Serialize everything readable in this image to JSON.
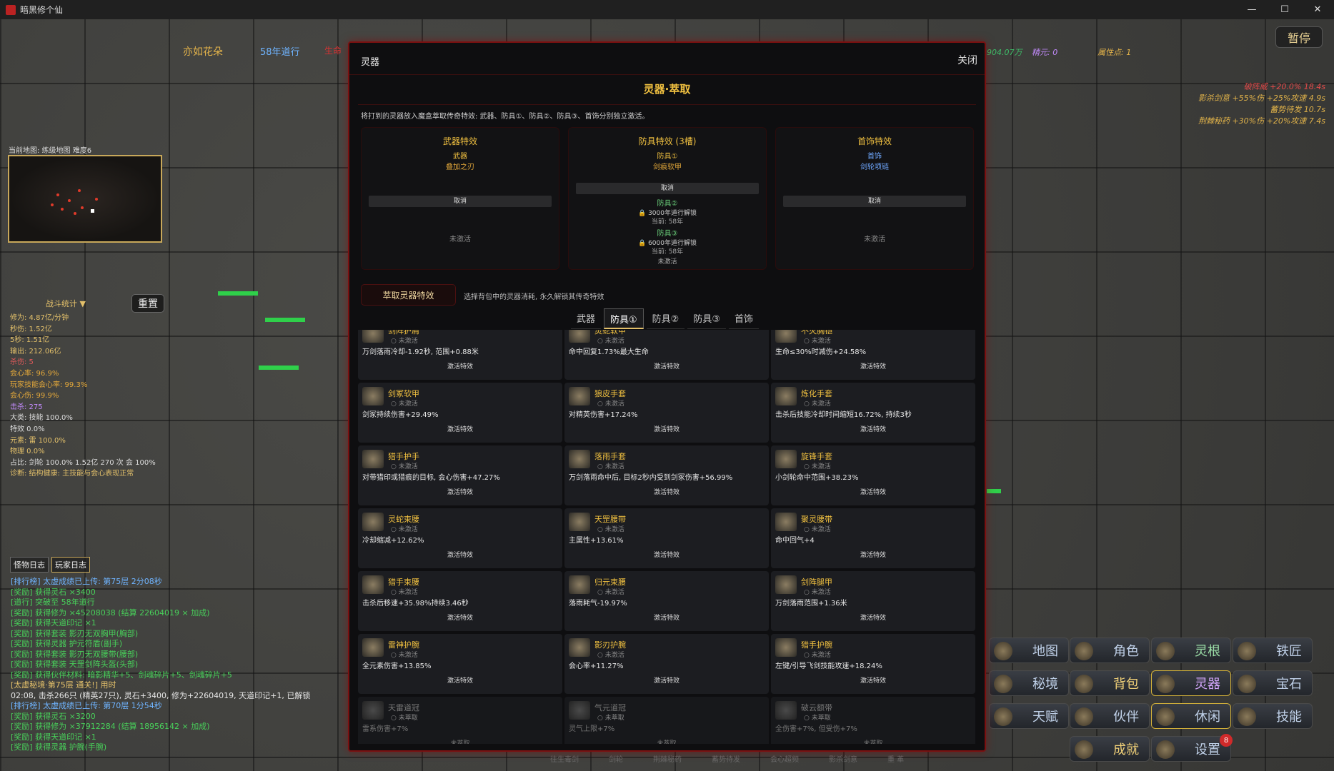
{
  "window": {
    "title": "暗黑修个仙",
    "min": "—",
    "max": "☐",
    "close": "✕"
  },
  "hud": {
    "name": "亦如花朵",
    "years": "58年道行",
    "hp_label": "生命",
    "stat1": "904.07万",
    "stat2": "精元: 0",
    "stat3": "属性点: 1",
    "pause": "暂停",
    "buffs": [
      "破阵威 +20.0% 18.4s",
      "影杀剑意 +55%伤 +25%攻速 4.9s",
      "蓄势待发 10.7s",
      "荆棘秘药 +30%伤 +20%攻速 7.4s"
    ]
  },
  "map": {
    "label": "当前地图: 练级地图 难度6"
  },
  "stats": {
    "title": "战斗统计 ▼",
    "reset": "重置",
    "lines": [
      {
        "t": "修为: 4.87亿/分钟",
        "c": "y"
      },
      {
        "t": "秒伤: 1.52亿",
        "c": "y"
      },
      {
        "t": "5秒: 1.51亿",
        "c": "y"
      },
      {
        "t": "输出: 212.06亿",
        "c": "y"
      },
      {
        "t": "杀伤: 5",
        "c": "r"
      },
      {
        "t": "会心率: 96.9%",
        "c": "o"
      },
      {
        "t": "玩家技能会心率: 99.3%",
        "c": "o"
      },
      {
        "t": "会心伤: 99.9%",
        "c": "o"
      },
      {
        "t": "击杀: 275",
        "c": "p"
      },
      {
        "t": "大类: 技能 100.0%",
        "c": "w"
      },
      {
        "t": "        特效 0.0%",
        "c": "w"
      },
      {
        "t": "元素: 雷 100.0%",
        "c": "y"
      },
      {
        "t": "        物理 0.0%",
        "c": "y"
      },
      {
        "t": "占比: 剑轮 100.0% 1.52亿 270 次 会 100%",
        "c": "w"
      },
      {
        "t": "诊断: 结构健康: 主技能与会心表现正常",
        "c": "y"
      }
    ]
  },
  "log": {
    "tabs": [
      "怪物日志",
      "玩家日志"
    ],
    "lines": [
      {
        "t": "[排行榜] 太虚成绩已上传: 第75层 2分08秒",
        "c": "c-rank"
      },
      {
        "t": "[奖励] 获得灵石 ×3400",
        "c": "c-reward"
      },
      {
        "t": "[道行] 突破至 58年道行",
        "c": "c-reward"
      },
      {
        "t": "[奖励] 获得修为 ×45208038 (结算 22604019 × 加成)",
        "c": "c-reward"
      },
      {
        "t": "[奖励] 获得天道印记 ×1",
        "c": "c-reward"
      },
      {
        "t": "[奖励] 获得套装 影刃无双胸甲(胸部)",
        "c": "c-reward"
      },
      {
        "t": "[奖励] 获得灵器 护元符盾(副手)",
        "c": "c-reward"
      },
      {
        "t": "[奖励] 获得套装 影刃无双腰带(腰部)",
        "c": "c-reward"
      },
      {
        "t": "[奖励] 获得套装 天罡剑阵头盔(头部)",
        "c": "c-reward"
      },
      {
        "t": "[奖励] 获得伙伴材料: 暗影精华+5、剑魂碎片+5、剑魂碎片+5",
        "c": "c-reward"
      },
      {
        "t": "[太虚秘境·第75层 通关!] 用时",
        "c": "c-pass"
      },
      {
        "t": "02:08, 击杀266只 (精英27只), 灵石+3400, 修为+22604019, 天道印记+1, 已解锁",
        "c": "c-white"
      },
      {
        "t": "[排行榜] 太虚成绩已上传: 第70层 1分54秒",
        "c": "c-rank"
      },
      {
        "t": "[奖励] 获得灵石 ×3200",
        "c": "c-reward"
      },
      {
        "t": "[奖励] 获得修为 ×37912284 (结算 18956142 × 加成)",
        "c": "c-reward"
      },
      {
        "t": "[奖励] 获得天道印记 ×1",
        "c": "c-reward"
      },
      {
        "t": "[奖励] 获得灵器 护腕(手腕)",
        "c": "c-reward"
      }
    ]
  },
  "buttons": [
    {
      "label": "地图",
      "cls": ""
    },
    {
      "label": "角色",
      "cls": ""
    },
    {
      "label": "灵根",
      "cls": "green"
    },
    {
      "label": "铁匠",
      "cls": ""
    },
    {
      "label": "秘境",
      "cls": ""
    },
    {
      "label": "背包",
      "cls": "gold"
    },
    {
      "label": "灵器",
      "cls": "purple hi"
    },
    {
      "label": "宝石",
      "cls": ""
    },
    {
      "label": "天赋",
      "cls": ""
    },
    {
      "label": "伙伴",
      "cls": ""
    },
    {
      "label": "休闲",
      "cls": "hi"
    },
    {
      "label": "技能",
      "cls": ""
    },
    {
      "label": "成就",
      "cls": "gold"
    },
    {
      "label": "设置",
      "cls": ""
    }
  ],
  "achievement_badge": "8",
  "bottom_strip": [
    "往生毒剑",
    "剑轮",
    "荆棘秘药",
    "蓄势待发",
    "会心超频",
    "影杀剑意",
    "重 革"
  ],
  "modal": {
    "title": "灵器",
    "close": "关闭",
    "section_title": "灵器·萃取",
    "desc": "将打到的灵器放入魔盒萃取传奇特效: 武器、防具①、防具②、防具③、首饰分别独立激活。",
    "cards": {
      "weapon": {
        "title": "武器特效",
        "slot": "武器",
        "effect": "叠加之刃",
        "cancel": "取消",
        "status": "未激活"
      },
      "armor": {
        "title": "防具特效 (3槽)",
        "slot1": "防具①",
        "effect1": "剑痕软甲",
        "cancel": "取消",
        "slot2": "防具②",
        "lock2": "🔒 3000年道行解锁",
        "cur2": "当前: 58年",
        "slot3": "防具③",
        "lock3": "🔒 6000年道行解锁",
        "cur3": "当前: 58年",
        "status": "未激活"
      },
      "jewel": {
        "title": "首饰特效",
        "slot": "首饰",
        "effect": "剑轮项链",
        "cancel": "取消",
        "status": "未激活"
      }
    },
    "extract_btn": "萃取灵器特效",
    "extract_desc": "选择背包中的灵器消耗, 永久解锁其传奇特效",
    "tabs": [
      "武器",
      "防具①",
      "防具②",
      "防具③",
      "首饰"
    ],
    "active_tab": 1,
    "items": [
      {
        "name": "剑阵护肩",
        "state": "○ 未激活",
        "effect": "万剑落雨冷却-1.92秒, 范围+0.88米",
        "action": "激活特效",
        "locked": false
      },
      {
        "name": "灵蛇软甲",
        "state": "○ 未激活",
        "effect": "命中回复1.73%最大生命",
        "action": "激活特效",
        "locked": false
      },
      {
        "name": "不灭胸铠",
        "state": "○ 未激活",
        "effect": "生命≤30%时减伤+24.58%",
        "action": "激活特效",
        "locked": false
      },
      {
        "name": "剑冢软甲",
        "state": "○ 未激活",
        "effect": "剑冢持续伤害+29.49%",
        "action": "激活特效",
        "locked": false
      },
      {
        "name": "狼皮手套",
        "state": "○ 未激活",
        "effect": "对精英伤害+17.24%",
        "action": "激活特效",
        "locked": false
      },
      {
        "name": "炼化手套",
        "state": "○ 未激活",
        "effect": "击杀后技能冷却时间缩短16.72%, 持续3秒",
        "action": "激活特效",
        "locked": false
      },
      {
        "name": "猎手护手",
        "state": "○ 未激活",
        "effect": "对带猎印或猎痕的目标, 会心伤害+47.27%",
        "action": "激活特效",
        "locked": false
      },
      {
        "name": "落雨手套",
        "state": "○ 未激活",
        "effect": "万剑落雨命中后, 目标2秒内受到剑冢伤害+56.99%",
        "action": "激活特效",
        "locked": false
      },
      {
        "name": "旋锋手套",
        "state": "○ 未激活",
        "effect": "小剑轮命中范围+38.23%",
        "action": "激活特效",
        "locked": false
      },
      {
        "name": "灵蛇束腰",
        "state": "○ 未激活",
        "effect": "冷却缩减+12.62%",
        "action": "激活特效",
        "locked": false
      },
      {
        "name": "天罡腰带",
        "state": "○ 未激活",
        "effect": "主属性+13.61%",
        "action": "激活特效",
        "locked": false
      },
      {
        "name": "聚灵腰带",
        "state": "○ 未激活",
        "effect": "命中回气+4",
        "action": "激活特效",
        "locked": false
      },
      {
        "name": "猎手束腰",
        "state": "○ 未激活",
        "effect": "击杀后移速+35.98%持续3.46秒",
        "action": "激活特效",
        "locked": false
      },
      {
        "name": "归元束腰",
        "state": "○ 未激活",
        "effect": "落雨耗气-19.97%",
        "action": "激活特效",
        "locked": false
      },
      {
        "name": "剑阵腿甲",
        "state": "○ 未激活",
        "effect": "万剑落雨范围+1.36米",
        "action": "激活特效",
        "locked": false
      },
      {
        "name": "雷神护腕",
        "state": "○ 未激活",
        "effect": "全元素伤害+13.85%",
        "action": "激活特效",
        "locked": false
      },
      {
        "name": "影刃护腕",
        "state": "○ 未激活",
        "effect": "会心率+11.27%",
        "action": "激活特效",
        "locked": false
      },
      {
        "name": "猎手护腕",
        "state": "○ 未激活",
        "effect": "左键/引导飞剑技能攻速+18.24%",
        "action": "激活特效",
        "locked": false
      },
      {
        "name": "天雷道冠",
        "state": "○ 未萃取",
        "effect": "雷系伤害+7%",
        "action": "未萃取",
        "locked": true
      },
      {
        "name": "气元道冠",
        "state": "○ 未萃取",
        "effect": "灵气上限+7%",
        "action": "未萃取",
        "locked": true
      },
      {
        "name": "破云额带",
        "state": "○ 未萃取",
        "effect": "全伤害+7%, 但受伤+7%",
        "action": "未萃取",
        "locked": true
      }
    ]
  }
}
